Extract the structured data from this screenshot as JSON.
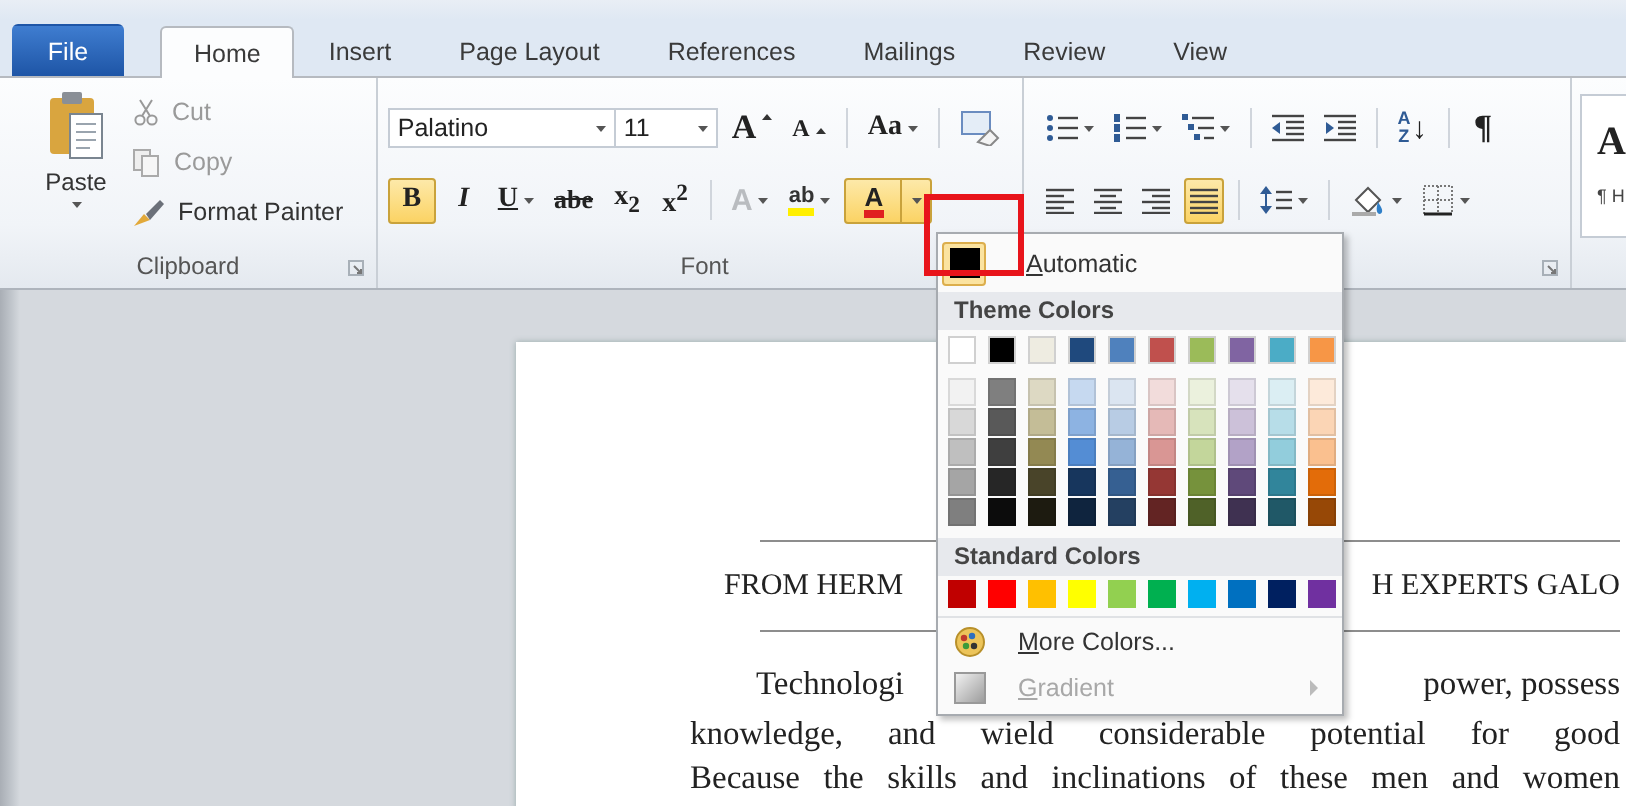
{
  "tabs": [
    {
      "label": "File",
      "kind": "file",
      "selected": false
    },
    {
      "label": "Home",
      "kind": "tab",
      "selected": true
    },
    {
      "label": "Insert",
      "kind": "tab",
      "selected": false
    },
    {
      "label": "Page Layout",
      "kind": "tab",
      "selected": false
    },
    {
      "label": "References",
      "kind": "tab",
      "selected": false
    },
    {
      "label": "Mailings",
      "kind": "tab",
      "selected": false
    },
    {
      "label": "Review",
      "kind": "tab",
      "selected": false
    },
    {
      "label": "View",
      "kind": "tab",
      "selected": false
    }
  ],
  "clipboard": {
    "paste": {
      "label": "Paste"
    },
    "items": [
      {
        "label": "Cut",
        "kind": "cut",
        "disabled": true
      },
      {
        "label": "Copy",
        "kind": "copy",
        "disabled": true
      },
      {
        "label": "Format Painter",
        "kind": "painter",
        "disabled": false
      }
    ],
    "group_label": "Clipboard"
  },
  "font": {
    "font_name": "Palatino",
    "font_size": "11",
    "row1": [
      {
        "kind": "grow",
        "label": "A"
      },
      {
        "kind": "shrink",
        "label": "A"
      },
      {
        "kind": "case",
        "label": "Aa"
      },
      {
        "kind": "clear"
      }
    ],
    "row2": [
      {
        "kind": "bold",
        "label": "B",
        "on": true,
        "disabled": false
      },
      {
        "kind": "italic",
        "label": "I",
        "on": false,
        "disabled": false
      },
      {
        "kind": "underline",
        "label": "U",
        "on": false,
        "disabled": false
      },
      {
        "kind": "strike",
        "label": "abe",
        "on": false,
        "disabled": false
      },
      {
        "kind": "sub",
        "label": "x$_{2}$",
        "on": false,
        "disabled": false
      },
      {
        "kind": "sup",
        "label": "x$^{2}$",
        "on": false,
        "disabled": false
      },
      {
        "kind": "effects",
        "label": "A",
        "on": false,
        "disabled": true
      },
      {
        "kind": "highlight",
        "label": "ab",
        "on": false,
        "disabled": false
      },
      {
        "kind": "color",
        "label": "A",
        "on": true,
        "disabled": false
      }
    ],
    "group_label": "Font"
  },
  "paragraph": {
    "row1": [
      {
        "kind": "bullets"
      },
      {
        "kind": "numbering"
      },
      {
        "kind": "multilevel"
      },
      {
        "kind": "outdent"
      },
      {
        "kind": "indent"
      },
      {
        "kind": "sort",
        "label": "A Z",
        "arrow": "↓"
      },
      {
        "kind": "pilcrow",
        "label": "¶"
      }
    ],
    "row2": [
      {
        "kind": "align_left",
        "on": false
      },
      {
        "kind": "center",
        "on": false
      },
      {
        "kind": "align_right",
        "on": false
      },
      {
        "kind": "justify",
        "on": true
      },
      {
        "kind": "spacing",
        "on": false
      },
      {
        "kind": "shading",
        "on": false
      },
      {
        "kind": "borders",
        "on": false
      }
    ]
  },
  "styles": {
    "sample": "A",
    "caption": "¶ H"
  },
  "annotation_frame": true,
  "color_menu": {
    "automatic": {
      "label": "Automatic",
      "color": "#000000",
      "selected": true
    },
    "theme_heading": "Theme Colors",
    "theme_colors": [
      {
        "color": "#ffffff",
        "shades": [
          {
            "color": "#f2f2f2"
          },
          {
            "color": "#d8d8d8"
          },
          {
            "color": "#bfbfbf"
          },
          {
            "color": "#a5a5a5"
          },
          {
            "color": "#7f7f7f"
          }
        ]
      },
      {
        "color": "#000000",
        "shades": [
          {
            "color": "#7f7f7f"
          },
          {
            "color": "#595959"
          },
          {
            "color": "#3f3f3f"
          },
          {
            "color": "#262626"
          },
          {
            "color": "#0c0c0c"
          }
        ]
      },
      {
        "color": "#eeece1",
        "shades": [
          {
            "color": "#ddd9c3"
          },
          {
            "color": "#c4bd97"
          },
          {
            "color": "#938953"
          },
          {
            "color": "#494429"
          },
          {
            "color": "#1d1b10"
          }
        ]
      },
      {
        "color": "#1f497d",
        "shades": [
          {
            "color": "#c6d9f0"
          },
          {
            "color": "#8db3e2"
          },
          {
            "color": "#548dd4"
          },
          {
            "color": "#17365d"
          },
          {
            "color": "#0f243e"
          }
        ]
      },
      {
        "color": "#4f81bd",
        "shades": [
          {
            "color": "#dbe5f1"
          },
          {
            "color": "#b8cce4"
          },
          {
            "color": "#95b3d7"
          },
          {
            "color": "#366092"
          },
          {
            "color": "#244061"
          }
        ]
      },
      {
        "color": "#c0504d",
        "shades": [
          {
            "color": "#f2dcdb"
          },
          {
            "color": "#e5b9b7"
          },
          {
            "color": "#d99694"
          },
          {
            "color": "#953734"
          },
          {
            "color": "#632423"
          }
        ]
      },
      {
        "color": "#9bbb59",
        "shades": [
          {
            "color": "#ebf1dd"
          },
          {
            "color": "#d7e3bc"
          },
          {
            "color": "#c3d69b"
          },
          {
            "color": "#76923c"
          },
          {
            "color": "#4f6128"
          }
        ]
      },
      {
        "color": "#8064a2",
        "shades": [
          {
            "color": "#e5e0ec"
          },
          {
            "color": "#ccc1d9"
          },
          {
            "color": "#b2a2c7"
          },
          {
            "color": "#5f497a"
          },
          {
            "color": "#3f3151"
          }
        ]
      },
      {
        "color": "#4bacc6",
        "shades": [
          {
            "color": "#dbeef3"
          },
          {
            "color": "#b7dde8"
          },
          {
            "color": "#92cddc"
          },
          {
            "color": "#31859b"
          },
          {
            "color": "#205867"
          }
        ]
      },
      {
        "color": "#f79646",
        "shades": [
          {
            "color": "#fdeada"
          },
          {
            "color": "#fbd5b5"
          },
          {
            "color": "#fac08f"
          },
          {
            "color": "#e36c09"
          },
          {
            "color": "#974806"
          }
        ]
      }
    ],
    "standard_heading": "Standard Colors",
    "standard_colors": [
      {
        "color": "#c00000"
      },
      {
        "color": "#ff0000"
      },
      {
        "color": "#ffc000"
      },
      {
        "color": "#ffff00"
      },
      {
        "color": "#92d050"
      },
      {
        "color": "#00b050"
      },
      {
        "color": "#00b0f0"
      },
      {
        "color": "#0070c0"
      },
      {
        "color": "#002060"
      },
      {
        "color": "#7030a0"
      }
    ],
    "more": {
      "label": "More Colors...",
      "disabled": false
    },
    "gradient": {
      "label": "Gradient",
      "disabled": true
    }
  },
  "document": {
    "heading": [
      "FROM HERM",
      "H EXPERTS GALO"
    ],
    "first_line": [
      "Technologi",
      "power, possess"
    ],
    "lines": [
      "knowledge, and wield considerable potential for good",
      "Because the skills and inclinations of these men and women"
    ]
  }
}
